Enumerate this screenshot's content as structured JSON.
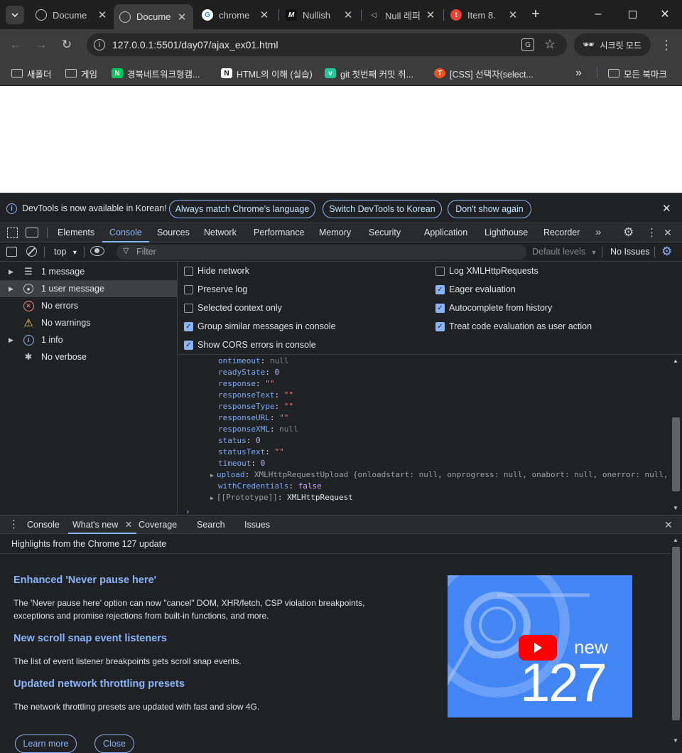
{
  "tabs": [
    {
      "title": "Docume",
      "favicon": "globe-icon",
      "active": false
    },
    {
      "title": "Docume",
      "favicon": "globe-icon",
      "active": true
    },
    {
      "title": "chrome",
      "favicon": "google-icon",
      "active": false
    },
    {
      "title": "Nullish",
      "favicon": "m-icon",
      "active": false
    },
    {
      "title": "Null 레퍼",
      "favicon": "vs-icon",
      "active": false
    },
    {
      "title": "Item 8.",
      "favicon": "red-circle-icon",
      "active": false
    }
  ],
  "address": {
    "url": "127.0.0.1:5501/day07/ajax_ex01.html"
  },
  "incognito_label": "시크릿 모드",
  "bookmarks": [
    {
      "label": "새폴더",
      "icon": "folder-icon"
    },
    {
      "label": "게임",
      "icon": "folder-icon"
    },
    {
      "label": "경북네트워크형캠...",
      "icon": "n-icon"
    },
    {
      "label": "HTML의 이해 (실습)",
      "icon": "notion-icon"
    },
    {
      "label": "git 첫번째 커밋 취...",
      "icon": "v-icon"
    },
    {
      "label": "[CSS] 선택자(select...",
      "icon": "tistory-icon"
    }
  ],
  "bookmarks_more": "»",
  "all_bookmarks": "모든 북마크",
  "infobar": {
    "message": "DevTools is now available in Korean!",
    "btn_match": "Always match Chrome's language",
    "btn_switch": "Switch DevTools to Korean",
    "btn_dont": "Don't show again"
  },
  "devtools_tabs": [
    "Elements",
    "Console",
    "Sources",
    "Network",
    "Performance",
    "Memory",
    "Security",
    "Application",
    "Lighthouse",
    "Recorder"
  ],
  "console_toolbar": {
    "context": "top",
    "filter_placeholder": "Filter",
    "levels": "Default levels",
    "issues": "No Issues"
  },
  "sidebar": [
    {
      "label": "1 message",
      "icon": "list-icon",
      "expandable": true,
      "selected": false
    },
    {
      "label": "1 user message",
      "icon": "user-icon",
      "expandable": true,
      "selected": true
    },
    {
      "label": "No errors",
      "icon": "error-icon",
      "expandable": false,
      "selected": false
    },
    {
      "label": "No warnings",
      "icon": "warning-icon",
      "expandable": false,
      "selected": false
    },
    {
      "label": "1 info",
      "icon": "info-icon",
      "expandable": true,
      "selected": false
    },
    {
      "label": "No verbose",
      "icon": "bug-icon",
      "expandable": false,
      "selected": false
    }
  ],
  "settings_left": [
    {
      "label": "Hide network",
      "checked": false
    },
    {
      "label": "Preserve log",
      "checked": false
    },
    {
      "label": "Selected context only",
      "checked": false
    },
    {
      "label": "Group similar messages in console",
      "checked": true
    },
    {
      "label": "Show CORS errors in console",
      "checked": true
    }
  ],
  "settings_right": [
    {
      "label": "Log XMLHttpRequests",
      "checked": false
    },
    {
      "label": "Eager evaluation",
      "checked": true
    },
    {
      "label": "Autocomplete from history",
      "checked": true
    },
    {
      "label": "Treat code evaluation as user action",
      "checked": true
    }
  ],
  "log": {
    "l0k": "ontimeout",
    "l0v": "null",
    "l1k": "readyState",
    "l1v": "0",
    "l2k": "response",
    "l2v": "\"\"",
    "l3k": "responseText",
    "l3v": "\"\"",
    "l4k": "responseType",
    "l4v": "\"\"",
    "l5k": "responseURL",
    "l5v": "\"\"",
    "l6k": "responseXML",
    "l6v": "null",
    "l7k": "status",
    "l7v": "0",
    "l8k": "statusText",
    "l8v": "\"\"",
    "l9k": "timeout",
    "l9v": "0",
    "l10k": "upload",
    "l10v": "XMLHttpRequestUpload {onloadstart: null, onprogress: null, onabort: null, onerror: null, onlo",
    "l11k": "withCredentials",
    "l11v": "false",
    "l12k": "[[Prototype]]",
    "l12v": "XMLHttpRequest"
  },
  "drawer_tabs": [
    "Console",
    "What's new",
    "Coverage",
    "Search",
    "Issues"
  ],
  "whats_new": {
    "heading": "Highlights from the Chrome 127 update",
    "h1": "Enhanced 'Never pause here'",
    "p1": "The 'Never pause here' option can now \"cancel\" DOM, XHR/fetch, CSP violation breakpoints, exceptions and promise rejections from built-in functions, and more.",
    "h2": "New scroll snap event listeners",
    "p2": "The list of event listener breakpoints gets scroll snap events.",
    "h3": "Updated network throttling presets",
    "p3": "The network throttling presets are updated with fast and slow 4G.",
    "learn_more": "Learn more",
    "close": "Close",
    "promo_new": "new",
    "promo_version": "127"
  },
  "colors": {
    "accent": "#8ab4f8",
    "promo_blue": "#4285f4",
    "youtube_red": "#ff0000"
  }
}
